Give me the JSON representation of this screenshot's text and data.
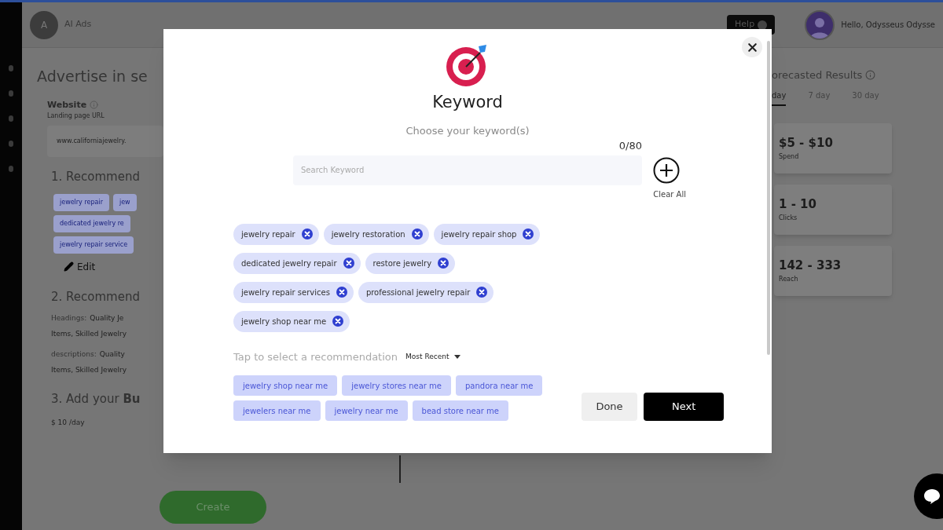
{
  "header": {
    "avatar_letter": "A",
    "app_name": "AI Ads",
    "help_button": "Help",
    "greeting": "Hello, Odysseus Odysse"
  },
  "page": {
    "title": "Advertise in se",
    "website_label": "Website",
    "website_hint": "Landing page URL",
    "website_value": "www.californiajewelry.",
    "section_1": "1. Recommend",
    "recommended_keywords": [
      "jewelry repair",
      "jew",
      "dedicated jewelry re",
      "jewelry repair service"
    ],
    "edit": "Edit",
    "section_2": "2. Recommend",
    "ad_text": [
      {
        "label": "Headings:",
        "lines": [
          "Quality Je",
          "Items, Skilled Jewelry"
        ]
      },
      {
        "label": "descriptions:",
        "lines": [
          "Quality",
          "Items, Skilled Jewelry"
        ]
      }
    ],
    "section_3": "3. Add your **Bu**",
    "budget": "$ 10 /day",
    "create_button": "Create"
  },
  "forecast": {
    "title": "orecasted Results",
    "tabs": [
      {
        "label": "day",
        "selected": true
      },
      {
        "label": "7 day",
        "selected": false
      },
      {
        "label": "30 day",
        "selected": false
      }
    ],
    "cards": [
      {
        "value": "$5 - $10",
        "label": "Spend"
      },
      {
        "value": "1 - 10",
        "label": "Clicks"
      },
      {
        "value": "142 - 333",
        "label": "Reach"
      }
    ]
  },
  "modal": {
    "title": "Keyword",
    "subtitle": "Choose your keyword(s)",
    "counter": "0/80",
    "search": {
      "placeholder": "Search Keyword"
    },
    "clear_all": "Clear All",
    "selected_keywords": [
      "jewelry repair",
      "jewelry restoration",
      "jewelry repair shop",
      "dedicated jewelry repair",
      "restore jewelry",
      "jewelry repair services",
      "professional jewelry repair",
      "jewelry shop near me"
    ],
    "recommendation_prompt": "Tap to select a recommendation",
    "sort": "Most Recent",
    "recommendations": [
      "jewelry shop near me",
      "jewelry stores near me",
      "pandora near me",
      "jewelers near me",
      "jewelry near me",
      "bead store near me"
    ],
    "done_button": "Done",
    "next_button": "Next"
  }
}
